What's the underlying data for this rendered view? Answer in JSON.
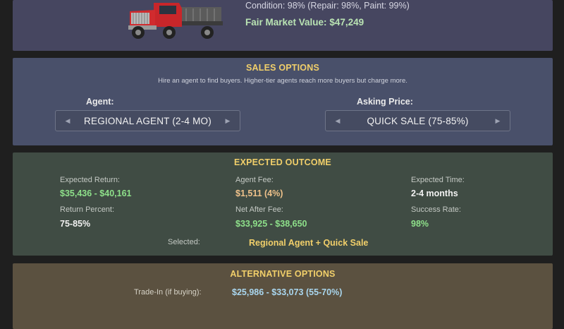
{
  "vehicle": {
    "condition_text": "Condition: 98% (Repair: 98%, Paint: 99%)",
    "fmv_label": "Fair Market Value:",
    "fmv_value": "$47,249"
  },
  "sales": {
    "title": "SALES OPTIONS",
    "subtitle": "Hire an agent to find buyers. Higher-tier agents reach more buyers but charge more.",
    "agent_label": "Agent:",
    "agent_value": "REGIONAL AGENT (2-4 MO)",
    "price_label": "Asking Price:",
    "price_value": "QUICK SALE (75-85%)",
    "arrow_left": "◀",
    "arrow_right": "▶"
  },
  "outcome": {
    "title": "EXPECTED OUTCOME",
    "expected_return_label": "Expected Return:",
    "expected_return_value": "$35,436 - $40,161",
    "agent_fee_label": "Agent Fee:",
    "agent_fee_value": "$1,511 (4%)",
    "expected_time_label": "Expected Time:",
    "expected_time_value": "2-4 months",
    "return_percent_label": "Return Percent:",
    "return_percent_value": "75-85%",
    "net_after_fee_label": "Net After Fee:",
    "net_after_fee_value": "$33,925 - $38,650",
    "success_rate_label": "Success Rate:",
    "success_rate_value": "98%",
    "selected_label": "Selected:",
    "selected_value": "Regional Agent + Quick Sale"
  },
  "alternatives": {
    "title": "ALTERNATIVE OPTIONS",
    "trade_in_label": "Trade-In (if buying):",
    "trade_in_value": "$25,986 - $33,073 (55-70%)"
  },
  "colors": {
    "accent_title": "#f1cf6a",
    "positive": "#8ee08a",
    "fee": "#eec18a",
    "trade_in": "#a9d6ee"
  }
}
